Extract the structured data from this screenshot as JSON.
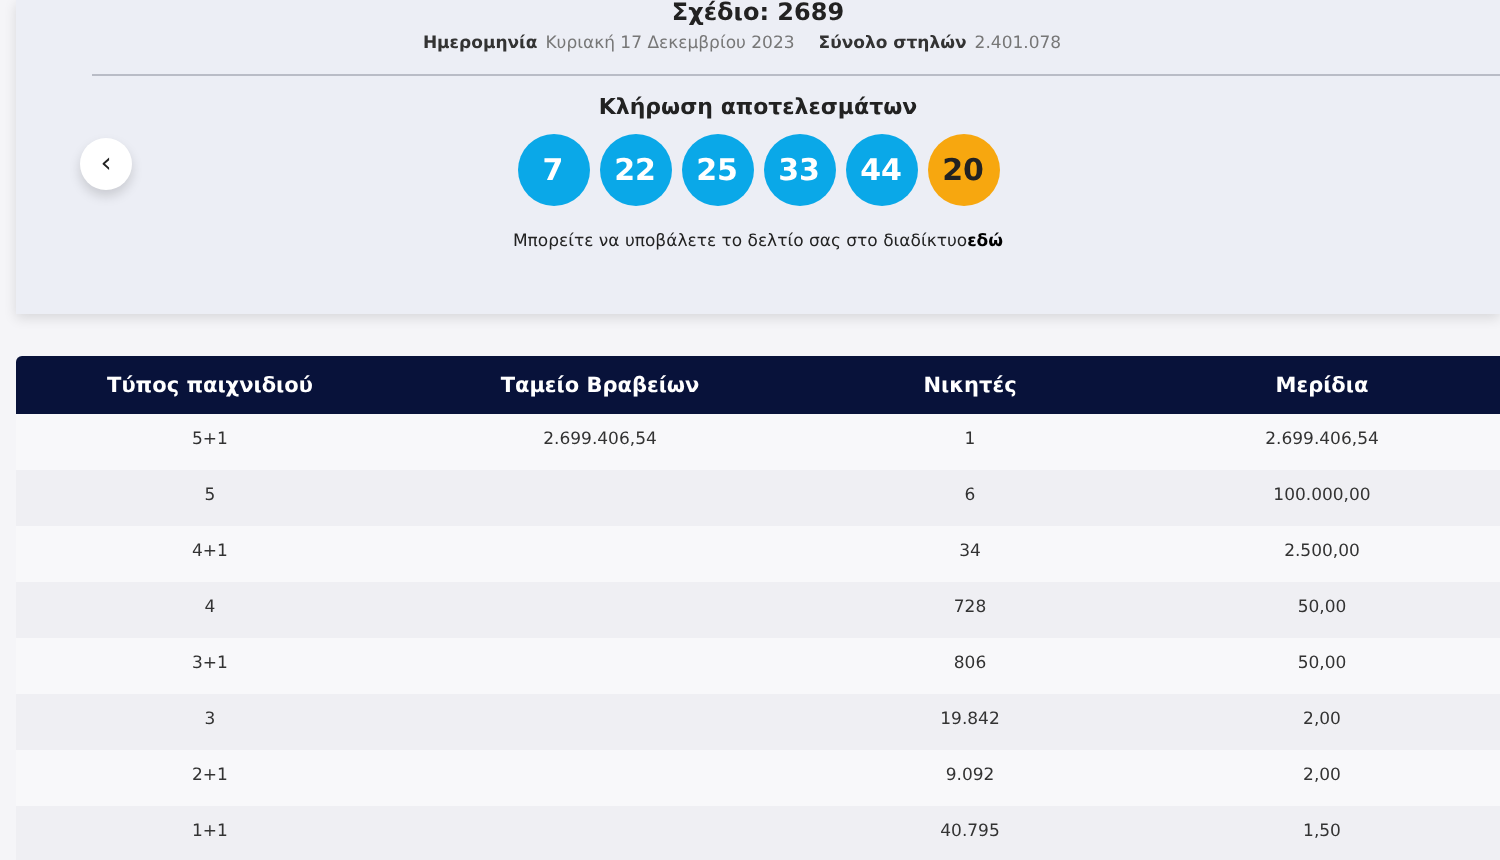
{
  "draw": {
    "title": "Σχέδιο: 2689",
    "date_label": "Ημερομηνία",
    "date_value": "Κυριακή 17 Δεκεμβρίου 2023",
    "total_label": "Σύνολο στηλών",
    "total_value": "2.401.078"
  },
  "results": {
    "heading": "Κλήρωση αποτελεσμάτων",
    "back": "‹",
    "balls": [
      {
        "number": "7",
        "kind": "main"
      },
      {
        "number": "22",
        "kind": "main"
      },
      {
        "number": "25",
        "kind": "main"
      },
      {
        "number": "33",
        "kind": "main"
      },
      {
        "number": "44",
        "kind": "main"
      },
      {
        "number": "20",
        "kind": "bonus"
      }
    ],
    "note": "Μπορείτε να υποβάλετε το δελτίο σας στο διαδίκτυο**εδώ**"
  },
  "table": {
    "columns": [
      "Τύπος παιχνιδιού",
      "Ταμείο Βραβείων",
      "Νικητές",
      "Μερίδια"
    ],
    "rows": [
      [
        "5+1",
        "2.699.406,54",
        "1",
        "2.699.406,54"
      ],
      [
        "5",
        "",
        "6",
        "100.000,00"
      ],
      [
        "4+1",
        "",
        "34",
        "2.500,00"
      ],
      [
        "4",
        "",
        "728",
        "50,00"
      ],
      [
        "3+1",
        "",
        "806",
        "50,00"
      ],
      [
        "3",
        "",
        "19.842",
        "2,00"
      ],
      [
        "2+1",
        "",
        "9.092",
        "2,00"
      ],
      [
        "1+1",
        "",
        "40.795",
        "1,50"
      ]
    ]
  }
}
